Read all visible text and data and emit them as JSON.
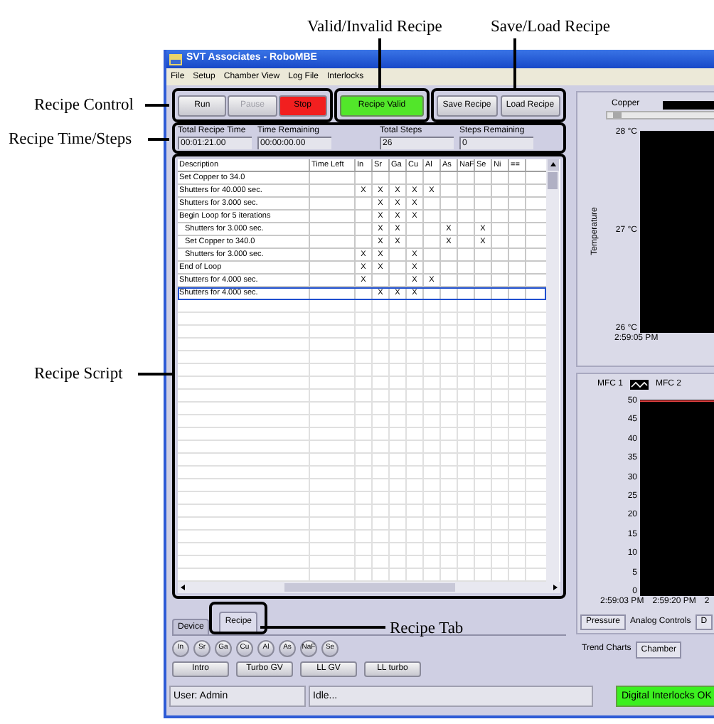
{
  "annotations": [
    {
      "text": "Valid/Invalid Recipe"
    },
    {
      "text": "Save/Load Recipe"
    },
    {
      "text": "Recipe Control"
    },
    {
      "text": "Recipe Time/Steps"
    },
    {
      "text": "Recipe Script"
    },
    {
      "text": "Recipe Tab"
    }
  ],
  "window": {
    "title": "SVT Associates - RoboMBE"
  },
  "menu": [
    "File",
    "Setup",
    "Chamber View",
    "Log File",
    "Interlocks"
  ],
  "recipe_control": [
    {
      "label": "Run",
      "kind": "plain",
      "disabled": false
    },
    {
      "label": "Pause",
      "kind": "plain",
      "disabled": true
    },
    {
      "label": "Stop",
      "kind": "stop",
      "disabled": false
    }
  ],
  "recipe_status": {
    "label": "Recipe Valid",
    "valid": true
  },
  "file_buttons": [
    "Save Recipe",
    "Load Recipe"
  ],
  "time_fields": [
    {
      "label": "Total Recipe Time",
      "value": "00:01:21.00"
    },
    {
      "label": "Time Remaining",
      "value": "00:00:00.00"
    },
    {
      "label": "Total Steps",
      "value": "26"
    },
    {
      "label": "Steps Remaining",
      "value": "0"
    }
  ],
  "table": {
    "columns": [
      "Description",
      "Time Left",
      "In",
      "Sr",
      "Ga",
      "Cu",
      "Al",
      "As",
      "NaF",
      "Se",
      "Ni",
      "=="
    ],
    "rows": [
      {
        "selected": false,
        "cells": [
          "Set Copper to 34.0",
          "",
          "",
          "",
          "",
          "",
          "",
          "",
          "",
          "",
          "",
          ""
        ]
      },
      {
        "selected": false,
        "cells": [
          "Shutters for 40.000 sec.",
          "",
          "X",
          "X",
          "X",
          "X",
          "X",
          "",
          "",
          "",
          "",
          ""
        ]
      },
      {
        "selected": false,
        "cells": [
          "Shutters for 3.000 sec.",
          "",
          "",
          "X",
          "X",
          "X",
          "",
          "",
          "",
          "",
          "",
          ""
        ]
      },
      {
        "selected": false,
        "cells": [
          "Begin Loop for 5 iterations",
          "",
          "",
          "X",
          "X",
          "X",
          "",
          "",
          "",
          "",
          "",
          ""
        ],
        "children": [
          {
            "selected": false,
            "cells": [
              "Shutters for 3.000 sec.",
              "",
              "",
              "X",
              "X",
              "",
              "",
              "X",
              "",
              "X",
              "",
              ""
            ]
          },
          {
            "selected": false,
            "cells": [
              "Set Copper to 340.0",
              "",
              "",
              "X",
              "X",
              "",
              "",
              "X",
              "",
              "X",
              "",
              ""
            ]
          },
          {
            "selected": false,
            "cells": [
              "Shutters for 3.000 sec.",
              "",
              "X",
              "X",
              "",
              "X",
              "",
              "",
              "",
              "",
              "",
              ""
            ]
          }
        ]
      },
      {
        "selected": false,
        "cells": [
          "End of Loop",
          "",
          "X",
          "X",
          "",
          "X",
          "",
          "",
          "",
          "",
          "",
          ""
        ]
      },
      {
        "selected": false,
        "cells": [
          "Shutters for 4.000 sec.",
          "",
          "X",
          "",
          "",
          "X",
          "X",
          "",
          "",
          "",
          "",
          ""
        ]
      },
      {
        "selected": true,
        "cells": [
          "Shutters for 4.000 sec.",
          "",
          "",
          "X",
          "X",
          "X",
          "",
          "",
          "",
          "",
          "",
          ""
        ]
      }
    ]
  },
  "left_tabs": [
    {
      "label": "Device",
      "selected": false
    },
    {
      "label": "Recipe",
      "selected": true
    }
  ],
  "shutter_buttons": [
    "In",
    "Sr",
    "Ga",
    "Cu",
    "Al",
    "As",
    "NaF",
    "Se"
  ],
  "valve_buttons": [
    "Intro",
    "Turbo GV",
    "LL GV",
    "LL turbo"
  ],
  "temperature_chart": {
    "channel_label": "Copper",
    "slider": {
      "level": 0.04
    },
    "y_axis_title": "Temperature",
    "y_ticks": [
      "28 °C",
      "27 °C",
      "26 °C"
    ],
    "x_ticks": [
      "2:59:05 PM"
    ]
  },
  "mfc_chart": {
    "legend": [
      "MFC 1",
      "MFC 2"
    ],
    "y_ticks": [
      "50",
      "45",
      "40",
      "35",
      "30",
      "25",
      "20",
      "15",
      "10",
      "5",
      "0"
    ],
    "x_ticks": [
      "2:59:03 PM",
      "2:59:20 PM",
      "2"
    ]
  },
  "chart_tabs": [
    {
      "label": "Pressure",
      "selected": false
    },
    {
      "label": "Analog Controls",
      "selected": true
    },
    {
      "label": "D",
      "selected": false
    }
  ],
  "view_tabs": [
    {
      "label": "Trend Charts",
      "selected": true
    },
    {
      "label": "Chamber",
      "selected": false
    }
  ],
  "status_bar": {
    "user": "User: Admin",
    "state": "Idle...",
    "interlocks": "Digital Interlocks OK",
    "interlocks_ok": true
  }
}
